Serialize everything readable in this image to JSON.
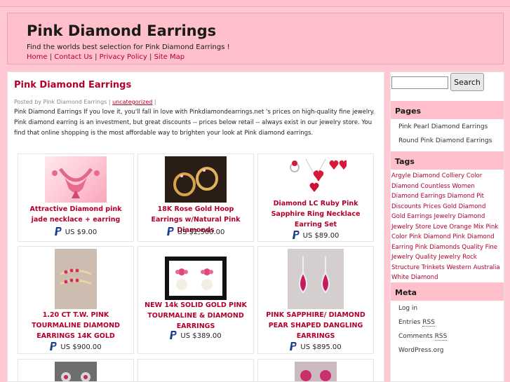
{
  "header": {
    "title": "Pink Diamond Earrings",
    "tagline": "Find the worlds best selection for Pink Diamond Earrings !",
    "nav": [
      "Home",
      "Contact Us",
      "Privacy Policy",
      "Site Map"
    ],
    "separator": "|"
  },
  "post": {
    "title": "Pink Diamond Earrings",
    "meta_prefix": "Posted by Pink Diamond Earrings |",
    "meta_category": "uncategorized",
    "meta_suffix": "|",
    "body": "Pink Diamond Earrings If you love it, you'll fall in love with Pinkdiamondearrings.net 's prices on high-quality fine jewelry. Pink diamond earring is an investment, but great discounts -- prices below retail -- always exist in our jewelry store. You find that online shopping is the most affordable way to brighten your look at Pink diamond earrings."
  },
  "products": [
    {
      "name": "Attractive Diamond pink jade necklace + earring",
      "price": "US $9.00",
      "icon": "paypal-icon"
    },
    {
      "name": "18K Rose Gold Hoop Earrings w/Natural Pink Diamonds",
      "price": "US $2,500.00",
      "icon": "paypal-icon"
    },
    {
      "name": "Diamond LC Ruby Pink Sapphire Ring Necklace Earring Set",
      "price": "US $89.00",
      "icon": "paypal-icon"
    },
    {
      "name": "1.20 CT T.W. PINK TOURMALINE DIAMOND EARRINGS 14K GOLD",
      "price": "US $900.00",
      "icon": "paypal-icon"
    },
    {
      "name": "NEW 14k SOLID GOLD PINK TOURMALINE & DIAMOND EARRINGS",
      "price": "US $389.00",
      "icon": "paypal-icon"
    },
    {
      "name": "PINK SAPPHIRE/ DIAMOND PEAR SHAPED DANGLING EARRINGS",
      "price": "US $895.00",
      "icon": "paypal-icon"
    }
  ],
  "sidebar": {
    "search": {
      "placeholder": "",
      "button": "Search"
    },
    "pages": {
      "title": "Pages",
      "items": [
        "Pink Pearl Diamond Earrings",
        "Round Pink Diamond Earrings"
      ]
    },
    "tags": {
      "title": "Tags",
      "items": [
        "Argyle",
        "Diamond",
        "Colliery",
        "Color",
        "Diamond",
        "Countless",
        "Women",
        "Diamond",
        "Earrings",
        "Diamond",
        "Pit",
        "Discounts",
        "Prices",
        "Gold",
        "Diamond",
        "Gold",
        "Earrings",
        "Jewelry",
        "Diamond",
        "Jewelry",
        "Store",
        "Love",
        "Orange",
        "Mix",
        "Pink",
        "Color",
        "Pink",
        "Diamond",
        "Pink",
        "Diamond",
        "Earring",
        "Pink",
        "Diamonds",
        "Quality",
        "Fine",
        "Jewelry",
        "Quality",
        "Jewelry",
        "Rock",
        "Structure",
        "Trinkets",
        "Western",
        "Australia",
        "White",
        "Diamond"
      ]
    },
    "meta": {
      "title": "Meta",
      "login": "Log in",
      "entries_prefix": "Entries",
      "entries_rss": "RSS",
      "comments_prefix": "Comments",
      "comments_rss": "RSS",
      "wordpress": "WordPress.org"
    }
  },
  "colors": {
    "accent": "#b2002c",
    "pink_bg": "#ffc8d2",
    "header_bg": "#ffbfcb"
  }
}
